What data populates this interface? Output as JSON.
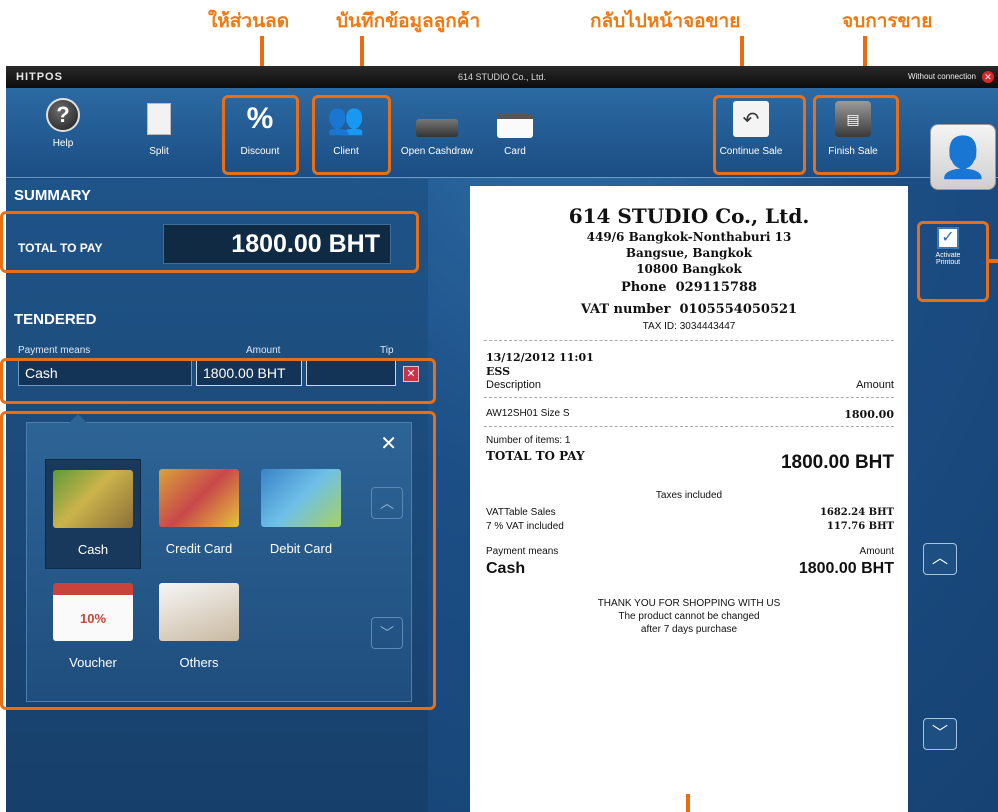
{
  "annotations": {
    "discount": "ให้ส่วนลด",
    "client": "บันทึกข้อมูลลูกค้า",
    "continue": "กลับไปหน้าจอขาย",
    "finish": "จบการขาย"
  },
  "titlebar": {
    "logo": "HITPOS",
    "company": "614 STUDIO Co., Ltd.",
    "status": "Without connection"
  },
  "toolbar": {
    "help": "Help",
    "split": "Split",
    "discount": "Discount",
    "client": "Client",
    "open_drawer": "Open Cashdraw",
    "card": "Card",
    "continue_sale": "Continue Sale",
    "finish_sale": "Finish Sale"
  },
  "summary": {
    "title": "SUMMARY",
    "total_label": "TOTAL TO PAY",
    "total_value": "1800.00 BHT"
  },
  "tendered": {
    "title": "TENDERED",
    "col_payment": "Payment means",
    "col_amount": "Amount",
    "col_tip": "Tip",
    "payment_value": "Cash",
    "amount_value": "1800.00 BHT",
    "tip_value": ""
  },
  "payment_methods": [
    "Cash",
    "Credit Card",
    "Debit Card",
    "Voucher",
    "Others"
  ],
  "voucher_pic_text": "10%",
  "receipt": {
    "company": "614 STUDIO Co., Ltd.",
    "addr1": "449/6 Bangkok-Nonthaburi 13",
    "addr2": "Bangsue, Bangkok",
    "addr3": "10800 Bangkok",
    "phone_label": "Phone",
    "phone": "029115788",
    "vat_label": "VAT number",
    "vat": "0105554050521",
    "taxid": "TAX ID: 3034443447",
    "datetime": "13/12/2012  11:01",
    "cashier": "ESS",
    "col_desc": "Description",
    "col_amount": "Amount",
    "item_desc": "AW12SH01 Size S",
    "item_amount": "1800.00",
    "items_count": "Number of items: 1",
    "total_label": "TOTAL TO PAY",
    "total_value": "1800.00 BHT",
    "taxes": "Taxes included",
    "vattable_label": "VATTable Sales",
    "vattable_value": "1682.24 BHT",
    "vat_incl_label": "7 % VAT included",
    "vat_incl_value": "117.76 BHT",
    "pm_label": "Payment means",
    "pm_amount_label": "Amount",
    "pm_value": "Cash",
    "pm_amount": "1800.00 BHT",
    "thanks1": "THANK YOU FOR SHOPPING WITH US",
    "thanks2": "The product cannot be changed",
    "thanks3": "after 7 days purchase"
  },
  "activate_printout": {
    "line1": "Activate",
    "line2": "Printout"
  },
  "colors": {
    "highlight": "#ea6f14",
    "panel": "#1f5488",
    "background": "#1c4f86"
  }
}
